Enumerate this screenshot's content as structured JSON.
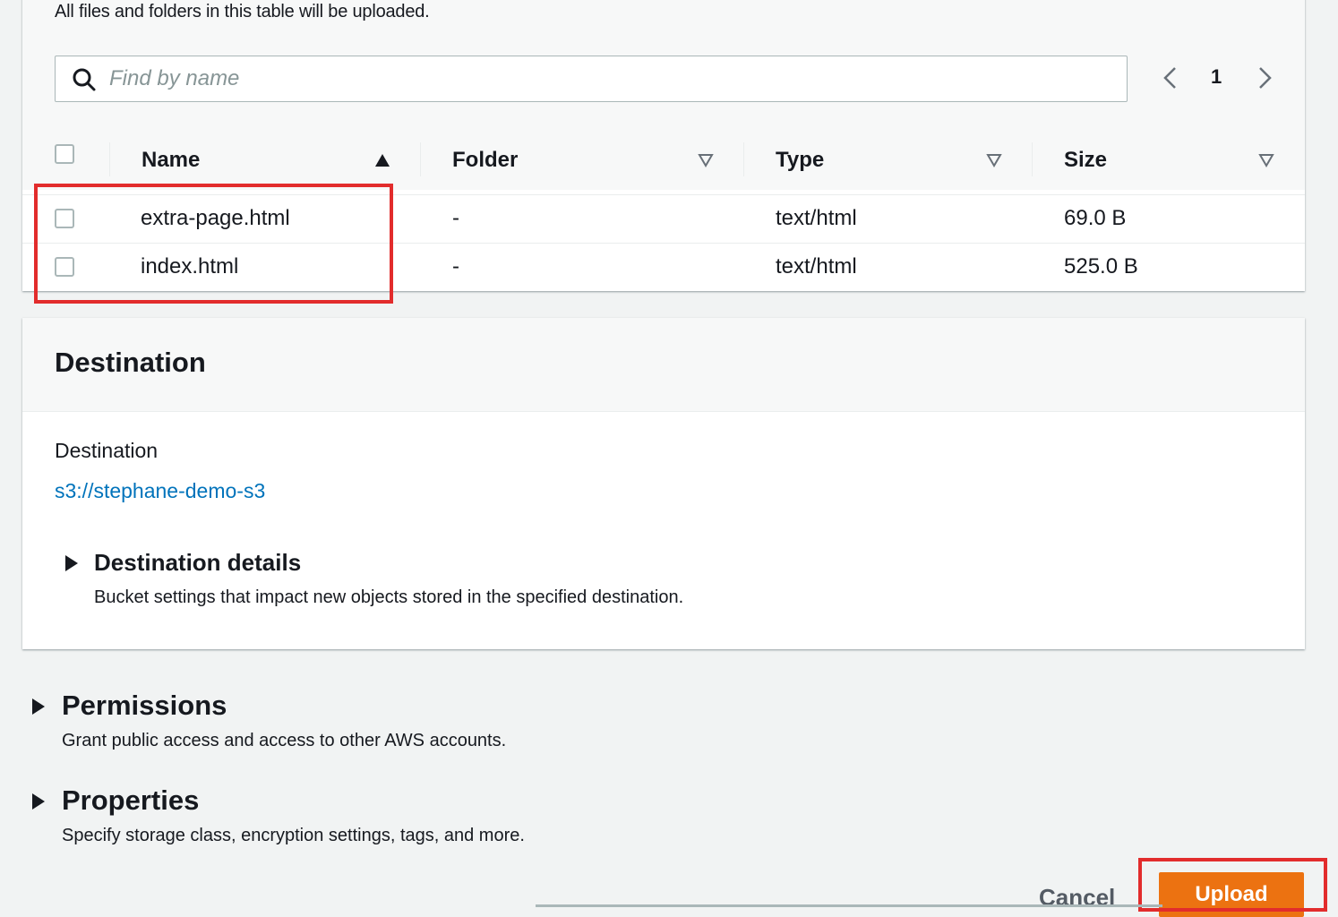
{
  "files": {
    "note": "All files and folders in this table will be uploaded.",
    "search": {
      "placeholder": "Find by name",
      "value": ""
    },
    "pagination": {
      "current_page": "1"
    },
    "columns": [
      "Name",
      "Folder",
      "Type",
      "Size"
    ],
    "rows": [
      {
        "name": "extra-page.html",
        "folder": "-",
        "type": "text/html",
        "size": "69.0 B"
      },
      {
        "name": "index.html",
        "folder": "-",
        "type": "text/html",
        "size": "525.0 B"
      }
    ]
  },
  "destination": {
    "section_title": "Destination",
    "label": "Destination",
    "bucket_link": "s3://stephane-demo-s3",
    "details_title": "Destination details",
    "details_desc": "Bucket settings that impact new objects stored in the specified destination."
  },
  "permissions": {
    "title": "Permissions",
    "desc": "Grant public access and access to other AWS accounts."
  },
  "properties": {
    "title": "Properties",
    "desc": "Specify storage class, encryption settings, tags, and more."
  },
  "actions": {
    "cancel_label": "Cancel",
    "upload_label": "Upload"
  },
  "colors": {
    "accent": "#ec7211",
    "link": "#0073bb",
    "highlight": "#e22c2c"
  },
  "icons": [
    "search-icon",
    "chevron-left-icon",
    "chevron-right-icon",
    "sort-ascending-icon",
    "sort-descending-icon",
    "caret-right-icon"
  ]
}
